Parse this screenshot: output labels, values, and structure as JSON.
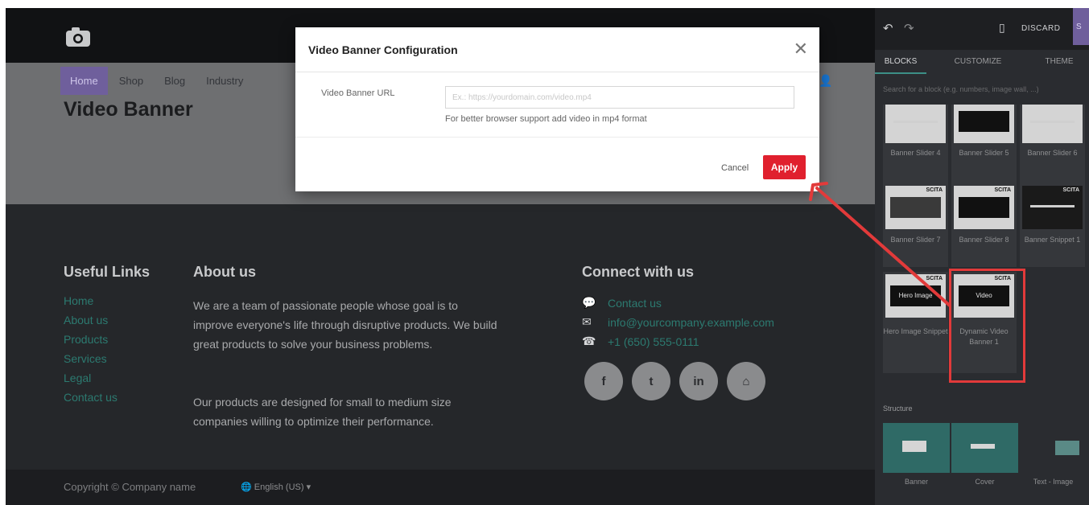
{
  "site": {
    "nav": [
      "Home",
      "Shop",
      "Blog",
      "Industry"
    ],
    "page_title": "Video Banner"
  },
  "footer": {
    "useful_links_heading": "Useful Links",
    "useful_links": [
      "Home",
      "About us",
      "Products",
      "Services",
      "Legal",
      "Contact us"
    ],
    "about_heading": "About us",
    "about_p1": "We are a team of passionate people whose goal is to improve everyone's life through disruptive products. We build great products to solve your business problems.",
    "about_p2": "Our products are designed for small to medium size companies willing to optimize their performance.",
    "connect_heading": "Connect with us",
    "contact_link": "Contact us",
    "email": "info@yourcompany.example.com",
    "phone": "+1 (650) 555-0111",
    "social": [
      "f",
      "t",
      "in",
      "⌂"
    ],
    "copyright": "Copyright © Company name",
    "language": "English (US)"
  },
  "modal": {
    "title": "Video Banner Configuration",
    "url_label": "Video Banner URL",
    "url_placeholder": "Ex.: https://yourdomain.com/video.mp4",
    "hint": "For better browser support add video in mp4 format",
    "cancel_label": "Cancel",
    "apply_label": "Apply"
  },
  "panel": {
    "discard_label": "DISCARD",
    "save_label": "S",
    "tabs": [
      "BLOCKS",
      "CUSTOMIZE",
      "THEME"
    ],
    "search_placeholder": "Search for a block (e.g. numbers, image wall, ...)",
    "blocks": [
      {
        "label": "Banner Slider 4"
      },
      {
        "label": "Banner Slider 5"
      },
      {
        "label": "Banner Slider 6"
      },
      {
        "label": "Banner Slider 7"
      },
      {
        "label": "Banner Slider 8"
      },
      {
        "label": "Banner Snippet 1"
      },
      {
        "label": "Hero Image Snippet",
        "inner": "Hero Image"
      },
      {
        "label": "Dynamic Video Banner 1",
        "inner": "Video"
      }
    ],
    "scta": "SCITA",
    "structure_label": "Structure",
    "structure": [
      "Banner",
      "Cover",
      "Text - Image"
    ]
  }
}
